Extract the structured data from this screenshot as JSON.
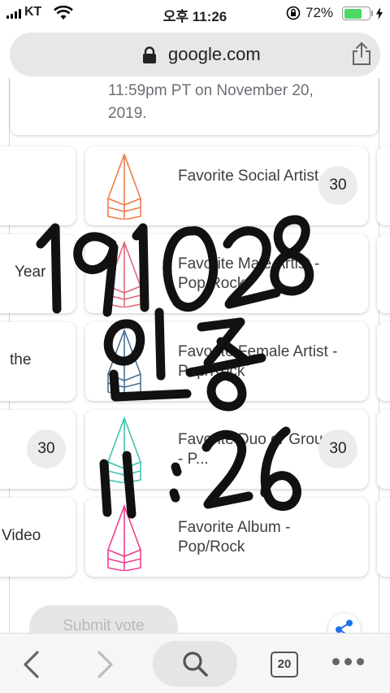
{
  "status_bar": {
    "carrier": "KT",
    "time": "오후 11:26",
    "battery_percent": "72%",
    "battery_level": 0.72
  },
  "browser": {
    "url": "google.com"
  },
  "page": {
    "deadline_text": "11:59pm PT on November 20, 2019.",
    "left_column": [
      {
        "label": ""
      },
      {
        "label": "Year"
      },
      {
        "label": "the"
      },
      {
        "label": "",
        "count": "30"
      },
      {
        "label": "Video"
      }
    ],
    "categories": [
      {
        "label": "Favorite Social Artist",
        "count": "30",
        "trophy_color": "#ee7c4d"
      },
      {
        "label": "Favorite Male Artist - Pop/Rock",
        "count": "",
        "trophy_color": "#e2657a"
      },
      {
        "label": "Favorite Female Artist - Pop/Rock",
        "count": "",
        "trophy_color": "#4a6f92"
      },
      {
        "label": "Favorite Duo or Group - P...",
        "count": "30",
        "trophy_color": "#3fc4ad"
      },
      {
        "label": "Favorite Album - Pop/Rock",
        "count": "",
        "trophy_color": "#ee3f8f"
      }
    ],
    "submit_label": "Submit vote",
    "share_color": "#1a73e8"
  },
  "toolbar": {
    "tab_count": "20"
  },
  "overlay": {
    "line1": "191028",
    "line2": "인증",
    "line3": "11:26"
  }
}
